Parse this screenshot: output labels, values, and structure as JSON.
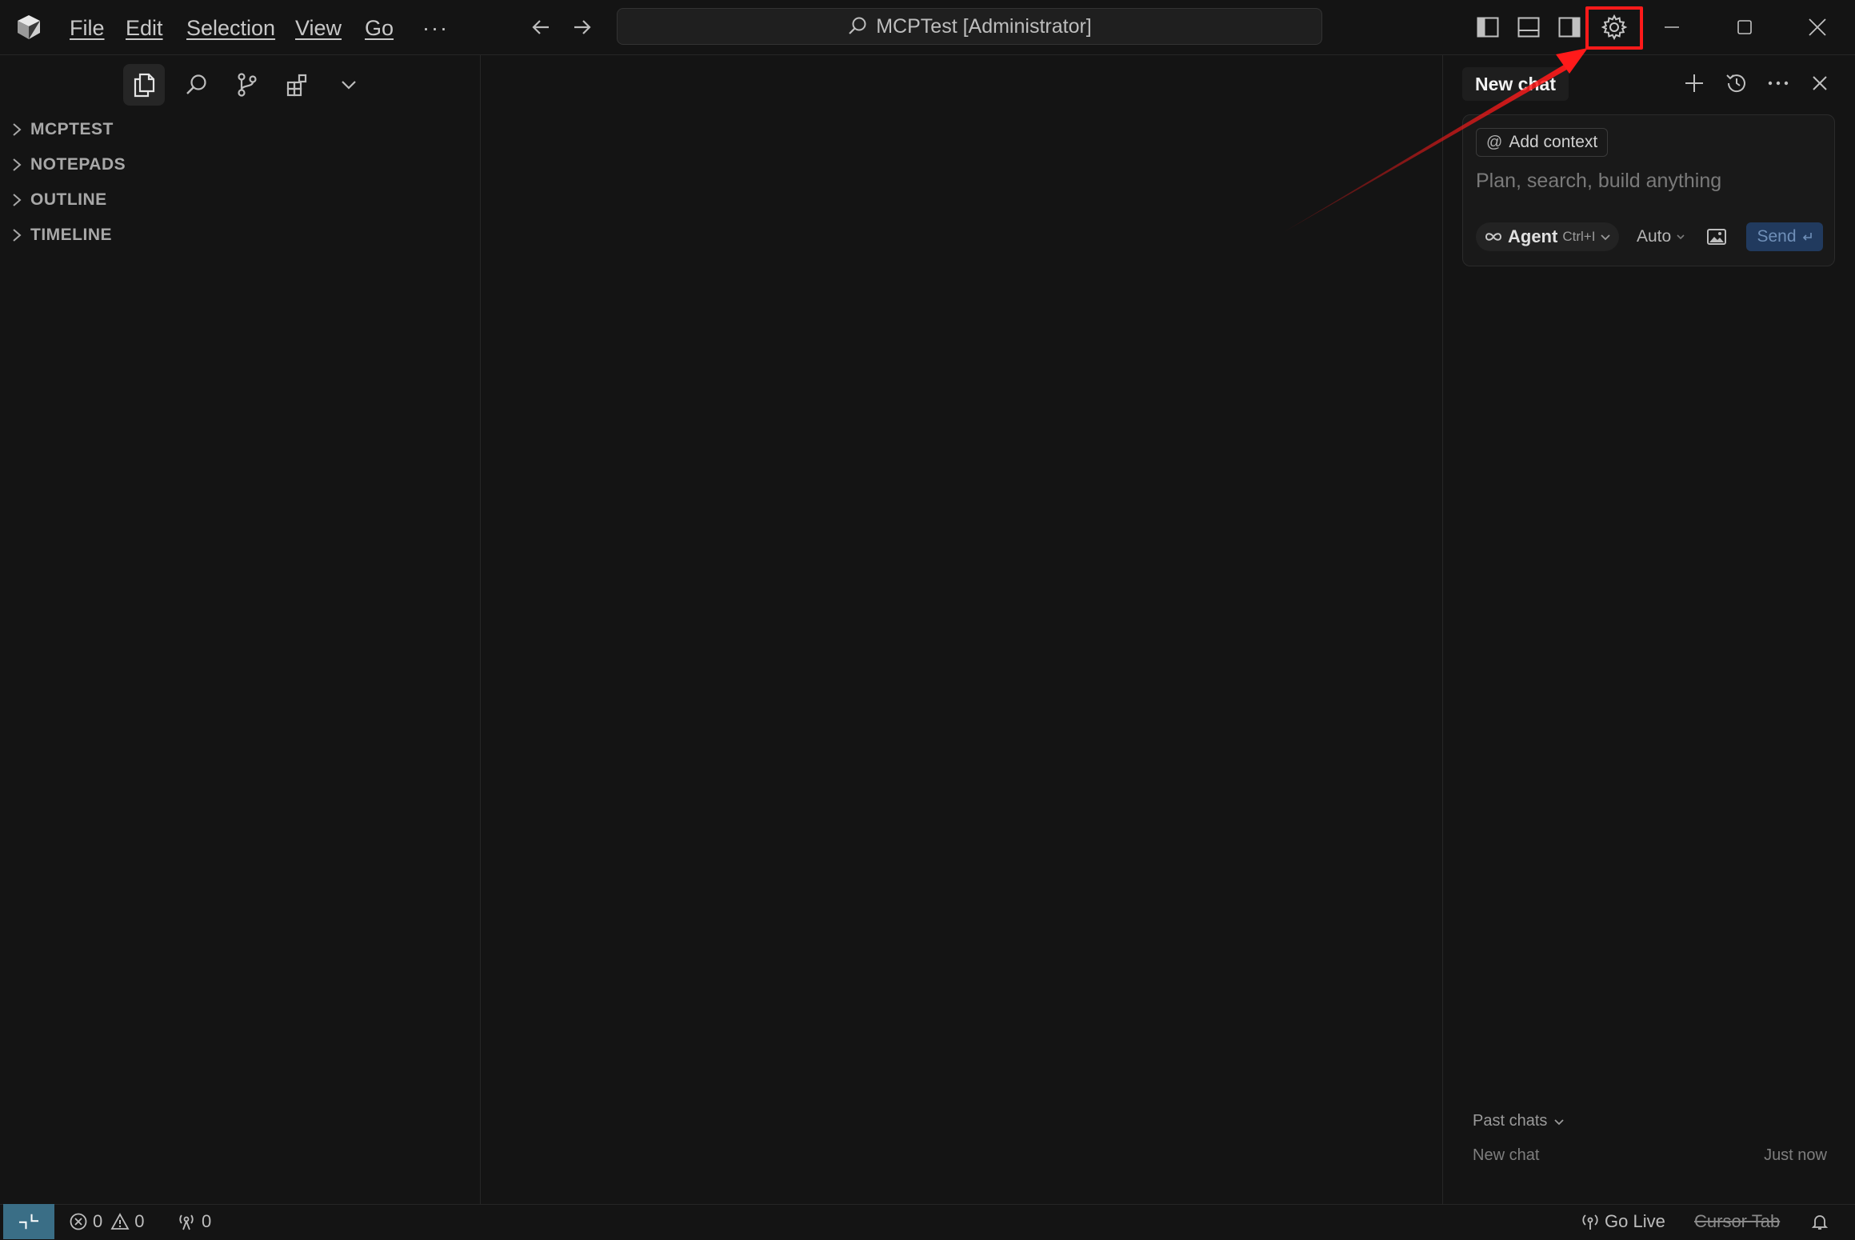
{
  "titlebar": {
    "menu": [
      "File",
      "Edit",
      "Selection",
      "View",
      "Go"
    ],
    "more": "···",
    "search_text": "MCPTest [Administrator]"
  },
  "sidebar": {
    "sections": [
      "MCPTEST",
      "NOTEPADS",
      "OUTLINE",
      "TIMELINE"
    ]
  },
  "chat": {
    "tab_title": "New chat",
    "add_context": "Add context",
    "placeholder": "Plan, search, build anything",
    "mode_label": "Agent",
    "mode_shortcut": "Ctrl+I",
    "model": "Auto",
    "send_label": "Send",
    "past_chats_label": "Past chats",
    "past_chats": [
      {
        "title": "New chat",
        "time": "Just now"
      }
    ]
  },
  "statusbar": {
    "errors": "0",
    "warnings": "0",
    "ports": "0",
    "go_live": "Go Live",
    "cursor_tab": "Cursor Tab"
  },
  "colors": {
    "background": "#141414",
    "highlight_box": "#ff1a1a",
    "annotation_arrow": "#ff1a1a",
    "send_button": "#213a5e",
    "remote_button": "#3a6e86"
  }
}
